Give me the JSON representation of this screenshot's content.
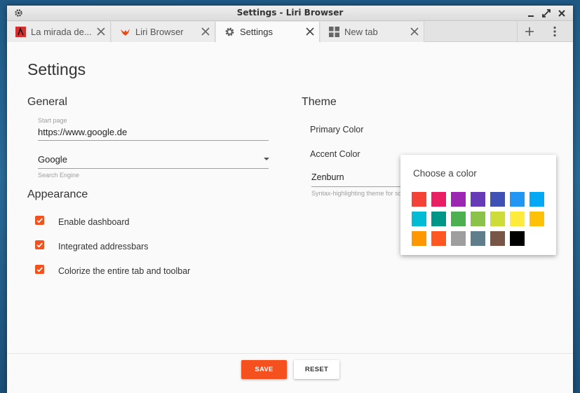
{
  "window": {
    "title": "Settings - Liri Browser"
  },
  "tabs": [
    {
      "label": "La mirada de...",
      "icon": "red-site-favicon"
    },
    {
      "label": "Liri Browser",
      "icon": "liri-bird-favicon"
    },
    {
      "label": "Settings",
      "icon": "gear-icon"
    },
    {
      "label": "New tab",
      "icon": "dashboard-grid-icon"
    }
  ],
  "page": {
    "title": "Settings"
  },
  "general": {
    "heading": "General",
    "start_page_label": "Start page",
    "start_page_value": "https://www.google.de",
    "search_engine_value": "Google",
    "search_engine_label": "Search Engine"
  },
  "appearance": {
    "heading": "Appearance",
    "options": [
      {
        "label": "Enable dashboard",
        "checked": true
      },
      {
        "label": "Integrated addressbars",
        "checked": true
      },
      {
        "label": "Colorize the entire tab and toolbar",
        "checked": true
      }
    ]
  },
  "theme": {
    "heading": "Theme",
    "primary_color_label": "Primary Color",
    "accent_color_label": "Accent Color",
    "syntax_value": "Zenburn",
    "syntax_label": "Syntax-highlighting theme for so"
  },
  "color_picker": {
    "title": "Choose a color",
    "colors": [
      "#f44336",
      "#e91e63",
      "#9c27b0",
      "#673ab7",
      "#3f51b5",
      "#2196f3",
      "#03a9f4",
      "#00bcd4",
      "#009688",
      "#4caf50",
      "#8bc34a",
      "#cddc39",
      "#ffeb3b",
      "#ffc107",
      "#ff9800",
      "#ff5722",
      "#9e9e9e",
      "#607d8b",
      "#795548",
      "#000000"
    ]
  },
  "actions": {
    "save_label": "SAVE",
    "reset_label": "RESET"
  },
  "colors": {
    "accent": "#f4511e"
  }
}
